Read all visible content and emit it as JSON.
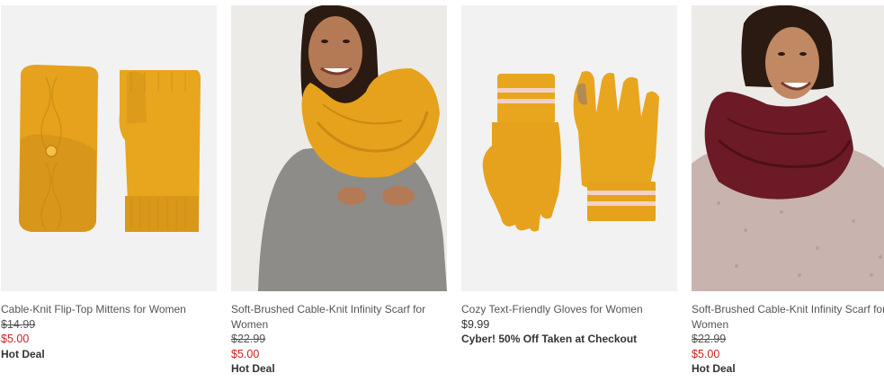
{
  "colors": {
    "sale_price": "#cc1f1f",
    "text": "#555555",
    "photo_bg": "#f1f1f1",
    "mustard": "#e8a51e",
    "burgundy": "#6b1a26"
  },
  "products": [
    {
      "name": "Cable-Knit Flip-Top Mittens for Women",
      "original_price": "$14.99",
      "sale_price": "$5.00",
      "badge": "Hot Deal",
      "image": "mustard-mittens-photo"
    },
    {
      "name": "Soft-Brushed Cable-Knit Infinity Scarf for Women",
      "original_price": "$22.99",
      "sale_price": "$5.00",
      "badge": "Hot Deal",
      "image": "mustard-scarf-model-photo"
    },
    {
      "name": "Cozy Text-Friendly Gloves for Women",
      "price": "$9.99",
      "badge": "Cyber! 50% Off Taken at Checkout",
      "image": "mustard-gloves-photo"
    },
    {
      "name": "Soft-Brushed Cable-Knit Infinity Scarf for Women",
      "original_price": "$22.99",
      "sale_price": "$5.00",
      "badge": "Hot Deal",
      "image": "burgundy-scarf-model-photo"
    }
  ]
}
